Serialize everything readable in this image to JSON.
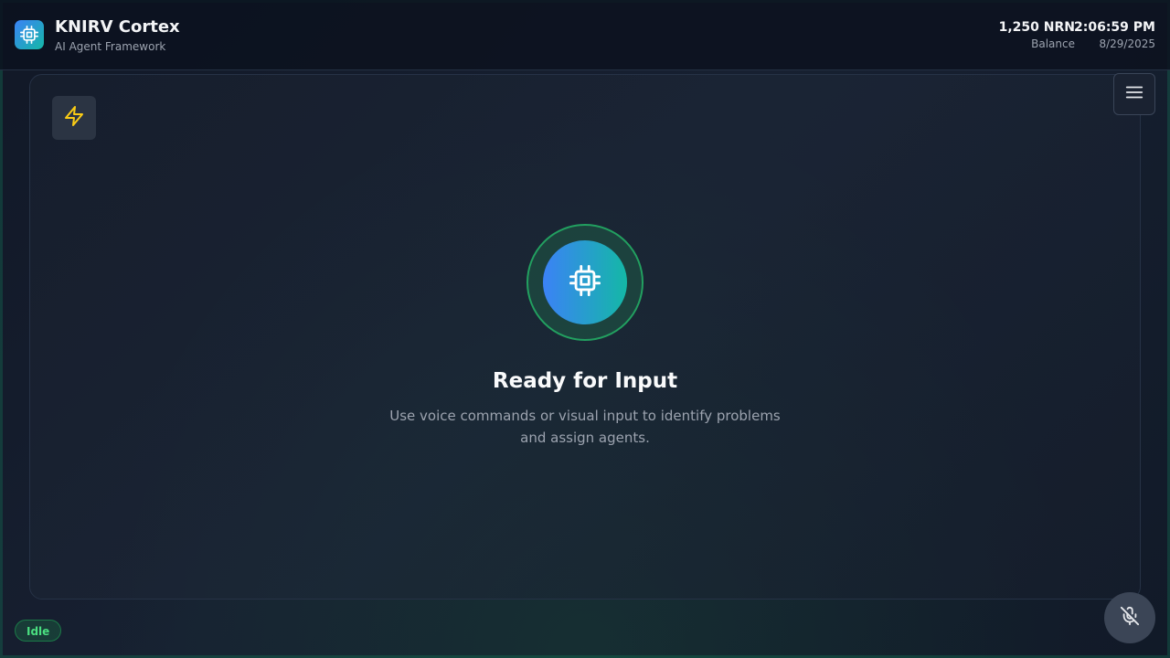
{
  "header": {
    "app_title": "KNIRV Cortex",
    "app_subtitle": "AI Agent Framework",
    "balance_value": "1,250 NRN",
    "balance_label": "Balance",
    "time": "2:06:59 PM",
    "date": "8/29/2025"
  },
  "main": {
    "title": "Ready for Input",
    "description": "Use voice commands or visual input to identify problems and assign agents."
  },
  "status": {
    "label": "Idle"
  },
  "icons": {
    "brand": "cpu-icon",
    "quick_action": "lightning-icon",
    "menu": "hamburger-menu-icon",
    "center": "cpu-icon",
    "mic": "mic-off-icon"
  },
  "colors": {
    "accent_blue": "#3b82f6",
    "accent_teal": "#14b8a6",
    "status_green": "#22c55e",
    "lightning_yellow": "#facc15"
  }
}
